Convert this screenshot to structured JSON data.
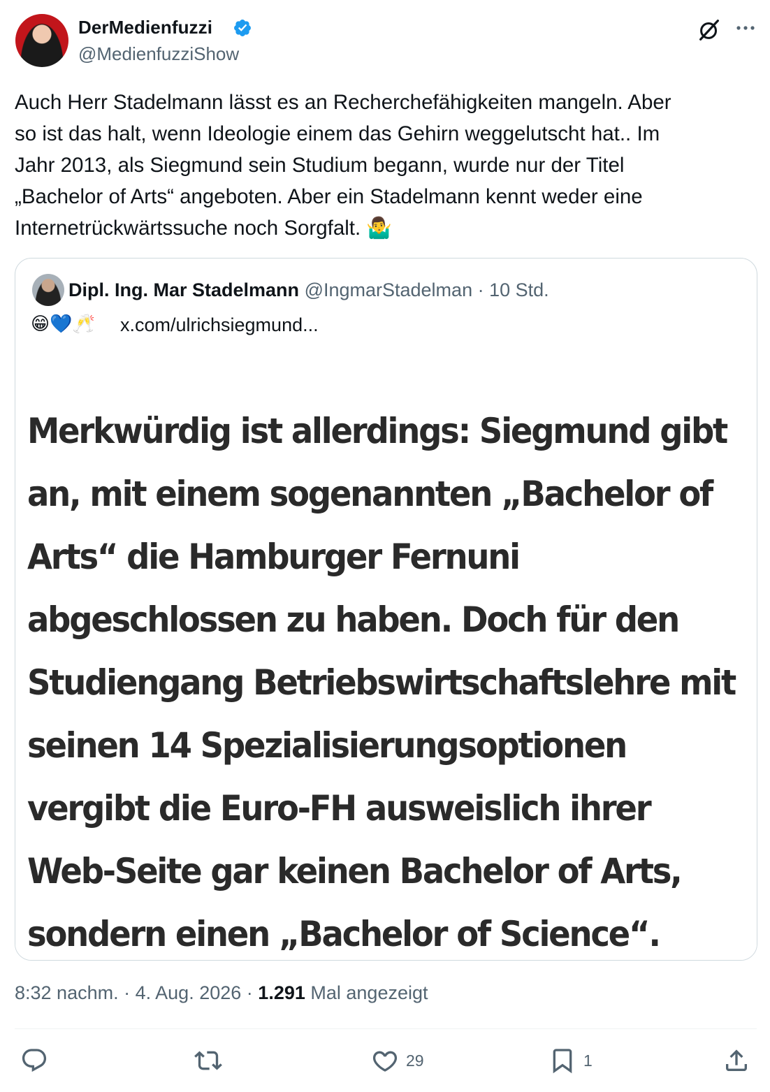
{
  "author": {
    "name": "DerMedienfuzzi",
    "handle": "@MedienfuzziShow",
    "verified": true
  },
  "tweet": {
    "lines": [
      "Auch Herr Stadelmann lässt es an Recherchefähigkeiten mangeln. Aber",
      "so ist das halt, wenn Ideologie einem das Gehirn weggelutscht hat.. Im",
      "Jahr 2013, als Siegmund sein Studium begann, wurde nur der Titel",
      "„Bachelor of Arts“ angeboten. Aber ein Stadelmann kennt weder eine",
      "Internetrückwärtssuche noch Sorgfalt. 🤷‍♂️"
    ]
  },
  "quote": {
    "name": "Dipl. Ing. Mar Stadelmann",
    "handle": "@IngmarStadelman",
    "separator": "·",
    "time": "10 Std.",
    "emojis": "😁💙🥂",
    "link": "x.com/ulrichsiegmund...",
    "image_text_lines": [
      "Merkwürdig ist allerdings: Siegmund gibt",
      "an, mit einem sogenannten „Bachelor of",
      "Arts“ die Hamburger Fernuni",
      "abgeschlossen zu haben. Doch für den",
      "Studiengang Betriebswirtschaftslehre mit",
      "seinen 14 Spezialisierungsoptionen",
      "vergibt die Euro-FH ausweislich ihrer",
      "Web-Seite gar keinen Bachelor of Arts,",
      "sondern einen „Bachelor of Science“."
    ]
  },
  "meta": {
    "time": "8:32 nachm.",
    "date": "4. Aug. 2026",
    "views_count": "1.291",
    "views_label": "Mal angezeigt"
  },
  "actions": {
    "reply_count": "",
    "retweet_count": "",
    "like_count": "29",
    "bookmark_count": "1"
  },
  "colors": {
    "text": "#0f1419",
    "secondary": "#536471",
    "border": "#cfd9de",
    "verified": "#1d9bf0"
  },
  "icons": [
    "grok-icon",
    "more-icon",
    "verified-badge-icon",
    "reply-icon",
    "retweet-icon",
    "like-icon",
    "bookmark-icon",
    "share-icon"
  ]
}
